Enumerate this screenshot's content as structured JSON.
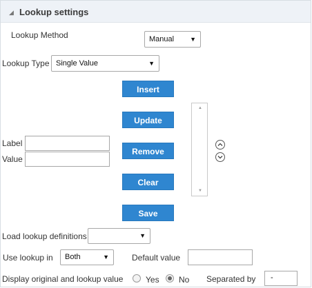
{
  "panel": {
    "title": "Lookup settings"
  },
  "lookup_method": {
    "label": "Lookup Method",
    "value": "Manual"
  },
  "lookup_type": {
    "label": "Lookup Type",
    "value": "Single Value"
  },
  "buttons": {
    "insert": "Insert",
    "update": "Update",
    "remove": "Remove",
    "clear": "Clear",
    "save": "Save"
  },
  "fields": {
    "label_label": "Label",
    "value_label": "Value",
    "label_value": "",
    "value_value": ""
  },
  "load_defs": {
    "label": "Load lookup definitions",
    "value": ""
  },
  "use_lookup": {
    "label": "Use lookup in",
    "value": "Both"
  },
  "default_value": {
    "label": "Default value",
    "value": ""
  },
  "display": {
    "label": "Display original and lookup value",
    "yes": "Yes",
    "no": "No",
    "selected": "No"
  },
  "separator": {
    "label": "Separated by",
    "value": "-"
  },
  "colors": {
    "button": "#2f86d0",
    "header": "#eef2f7"
  }
}
